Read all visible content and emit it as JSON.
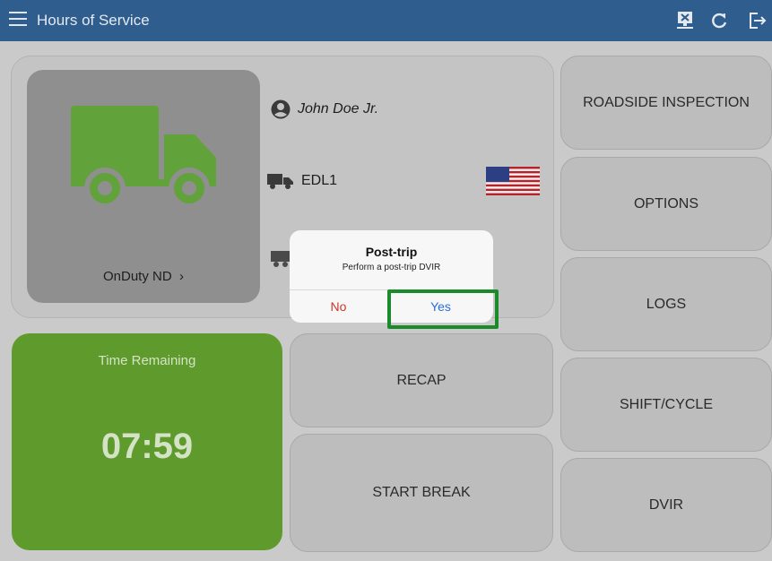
{
  "header": {
    "title": "Hours of Service",
    "icons": [
      "menu-icon",
      "disconnect-device-icon",
      "refresh-icon",
      "logout-icon"
    ]
  },
  "driver": {
    "name": "John Doe Jr.",
    "vehicle": "EDL1",
    "status": "OnDuty ND",
    "status_chevron": "›",
    "flag": "us-flag-icon"
  },
  "time_remaining": {
    "label": "Time Remaining",
    "value": "07:59"
  },
  "actions": {
    "roadside": "ROADSIDE INSPECTION",
    "options": "OPTIONS",
    "logs": "LOGS",
    "shift_cycle": "SHIFT/CYCLE",
    "dvir": "DVIR",
    "recap": "RECAP",
    "start_break": "START BREAK"
  },
  "dialog": {
    "title": "Post-trip",
    "message": "Perform a post-trip DVIR",
    "no": "No",
    "yes": "Yes"
  },
  "colors": {
    "header": "#2f5e8e",
    "truck": "#62a23a",
    "time_card": "#5f9b2c",
    "no_text": "#d0342c",
    "yes_text": "#2b6fd6",
    "highlight": "#1a8a2a"
  }
}
